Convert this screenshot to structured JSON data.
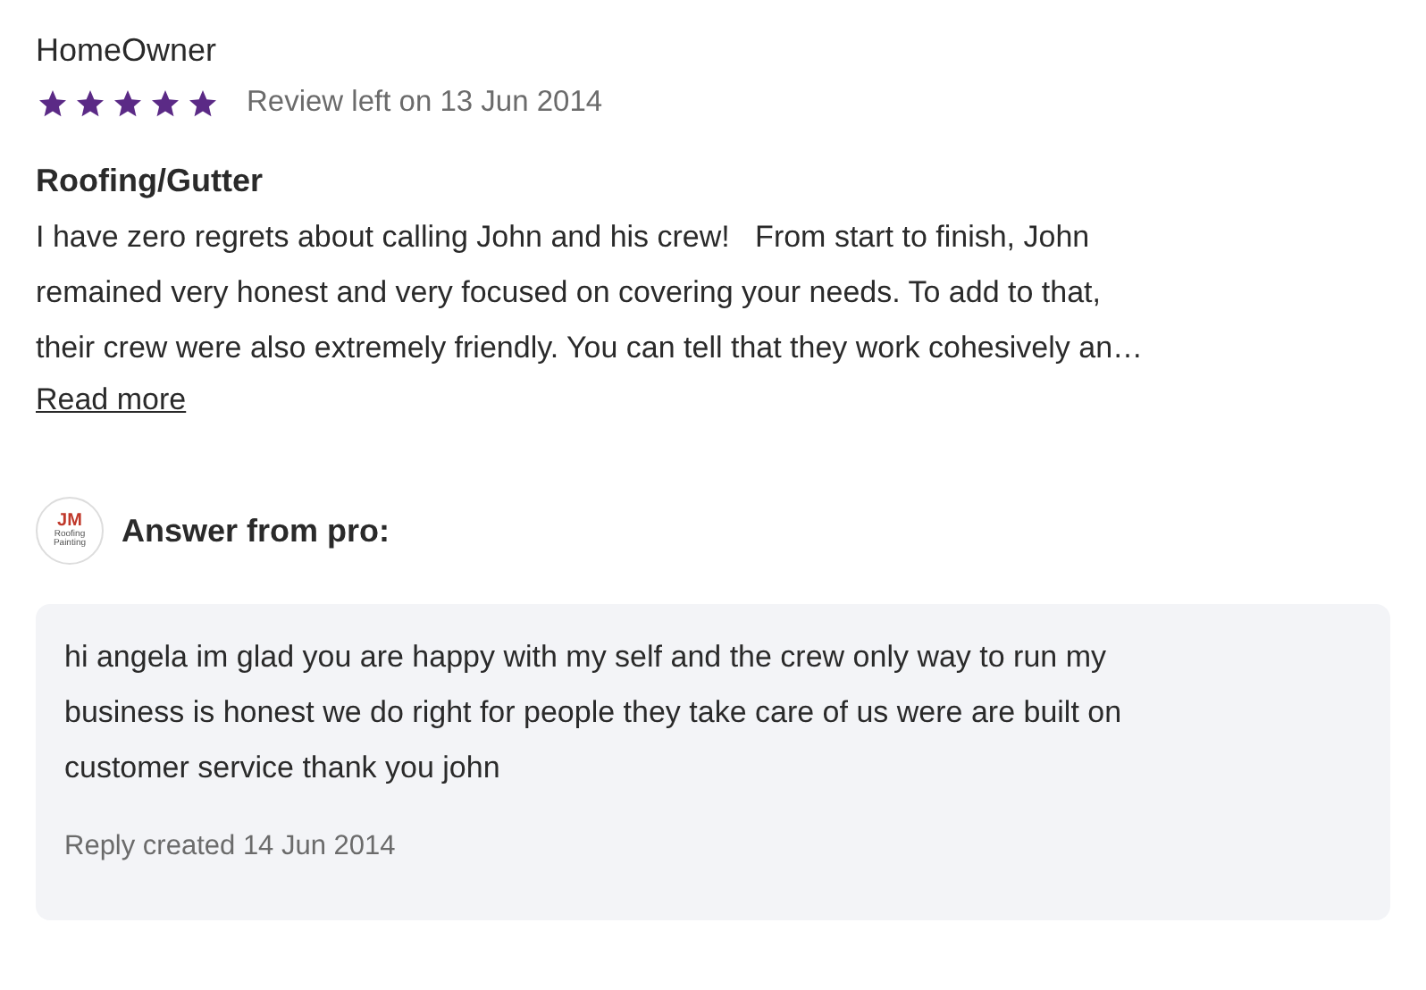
{
  "review": {
    "author": "HomeOwner",
    "stars": 5,
    "date": "Review left on 13 Jun 2014",
    "category": "Roofing/Gutter",
    "body": "I have zero regrets about calling John and his crew!   From start to finish, John\nremained very honest and very focused on covering your needs. To add to that,\ntheir crew were also extremely friendly. You can tell that they work cohesively an…",
    "read_more": "Read more"
  },
  "answer": {
    "logo": {
      "initials": "JM",
      "line_1": "Roofing",
      "line_2": "Painting"
    },
    "heading": "Answer from pro:",
    "body": "hi angela im glad you are happy with my self and the crew only way to run my\nbusiness is honest we do right for people they take care of us were are built on\ncustomer service thank you john",
    "date": "Reply created 14 Jun 2014"
  }
}
